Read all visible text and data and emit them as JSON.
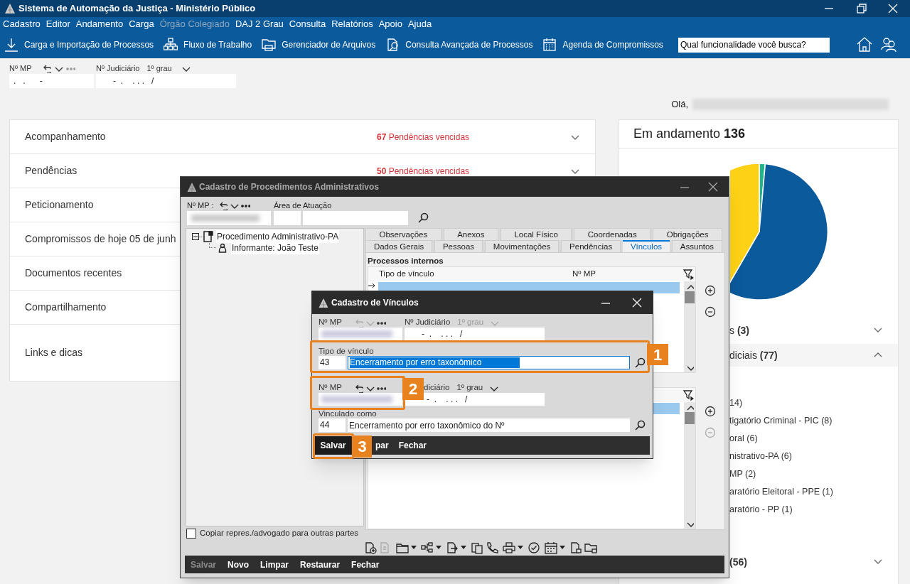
{
  "window": {
    "title": "Sistema de Automação da Justiça - Ministério Público"
  },
  "menu": [
    {
      "label": "Cadastro",
      "disabled": false
    },
    {
      "label": "Editor",
      "disabled": false
    },
    {
      "label": "Andamento",
      "disabled": false
    },
    {
      "label": "Carga",
      "disabled": false
    },
    {
      "label": "Órgão Colegiado",
      "disabled": true
    },
    {
      "label": "DAJ 2 Grau",
      "disabled": false
    },
    {
      "label": "Consulta",
      "disabled": false
    },
    {
      "label": "Relatórios",
      "disabled": false
    },
    {
      "label": "Apoio",
      "disabled": false
    },
    {
      "label": "Ajuda",
      "disabled": false
    }
  ],
  "toolbar": [
    {
      "label": "Carga e Importação de Processos",
      "kind": "download"
    },
    {
      "label": "Fluxo de Trabalho",
      "kind": "sitemap"
    },
    {
      "label": "Gerenciador de Arquivos",
      "kind": "folder"
    },
    {
      "label": "Consulta Avançada de Processos",
      "kind": "docsearch"
    },
    {
      "label": "Agenda de Compromissos",
      "kind": "calendar"
    }
  ],
  "search": {
    "placeholder": "Qual funcionalidade você busca?"
  },
  "process_bar": {
    "mp_label": "Nº MP",
    "mp_value": ".   .      -",
    "judicial_label": "Nº Judiciário",
    "grade": "1º grau",
    "judicial_value": "-  .    . . .   /"
  },
  "greeting": "Olá,",
  "sections": [
    {
      "title": "Acompanhamento",
      "alert": "**67** Pendências vencidas"
    },
    {
      "title": "Pendências",
      "alert": "**50** Pendências vencidas"
    },
    {
      "title": "Peticionamento"
    },
    {
      "title": "Compromissos de hoje 05 de junh"
    },
    {
      "title": "Documentos recentes"
    },
    {
      "title": "Compartilhamento"
    },
    {
      "title": "Links e dicas"
    }
  ],
  "summary": {
    "title": "Em andamento",
    "count": "136",
    "groups": [
      {
        "label": "s **(3)**",
        "expanded": false
      },
      {
        "label": "diciais **(77)**",
        "expanded": true,
        "items": [
          "14)",
          "tigatório Criminal - PIC (8)",
          "oral (6)",
          "nistrativo-PA (6)",
          "MP (2)",
          "aratório Eleitoral - PPE (1)",
          "aratório - PP (1)"
        ]
      },
      {
        "label": "**(56)**",
        "expanded": false
      }
    ]
  },
  "admin_dialog": {
    "title": "Cadastro de Procedimentos Administrativos",
    "mp_label": "Nº MP :",
    "area_label": "Área de Atuação",
    "tree": [
      {
        "label": "Procedimento Administrativo-PA",
        "expanded": true,
        "children": [
          {
            "label": "Informante: João Teste"
          }
        ]
      }
    ],
    "tab_rows": [
      [
        {
          "label": "Observações",
          "selected": false
        },
        {
          "label": "Anexos",
          "selected": false
        },
        {
          "label": "Local Físico",
          "selected": false
        },
        {
          "label": "Coordenadas",
          "selected": false
        },
        {
          "label": "Obrigações",
          "selected": false
        }
      ],
      [
        {
          "label": "Dados Gerais",
          "selected": false
        },
        {
          "label": "Pessoas",
          "selected": false
        },
        {
          "label": "Movimentações",
          "selected": false
        },
        {
          "label": "Pendências",
          "selected": false
        },
        {
          "label": "Vínculos",
          "selected": true
        },
        {
          "label": "Assuntos",
          "selected": false
        }
      ]
    ],
    "section_title": "Processos internos",
    "grid_columns": [
      "Tipo de vínculo",
      "Nº MP"
    ],
    "copy_checkbox": {
      "label": "Copiar repres./advogado para outras partes",
      "checked": false
    },
    "actions": [
      {
        "label": "Salvar",
        "disabled": true
      },
      {
        "label": "Novo",
        "disabled": false
      },
      {
        "label": "Limpar",
        "disabled": false
      },
      {
        "label": "Restaurar",
        "disabled": false
      },
      {
        "label": "Fechar",
        "disabled": false
      }
    ]
  },
  "link_dialog": {
    "title": "Cadastro de Vínculos",
    "mp_label": "Nº MP",
    "judicial_label": "Nº Judiciário",
    "grade": "1º grau",
    "judicial_value": "-  .    . . .   /",
    "type_label": "Tipo de vínculo",
    "type_code": "43",
    "type_value": "Encerramento por erro taxonômico",
    "target_mp_label": "Nº MP",
    "target_judicial_label": "diciário",
    "target_grade": "1º grau",
    "target_judicial_value": "-  .    . . .   /",
    "linked_label": "Vinculado como",
    "linked_code": "44",
    "linked_value": "Encerramento por erro taxonômico do Nº",
    "actions": [
      {
        "label": "Salvar",
        "focused": true
      },
      {
        "label": "par",
        "focused": false
      },
      {
        "label": "Fechar",
        "focused": false
      }
    ]
  },
  "annotations": [
    {
      "number": "1"
    },
    {
      "number": "2"
    },
    {
      "number": "3"
    }
  ]
}
